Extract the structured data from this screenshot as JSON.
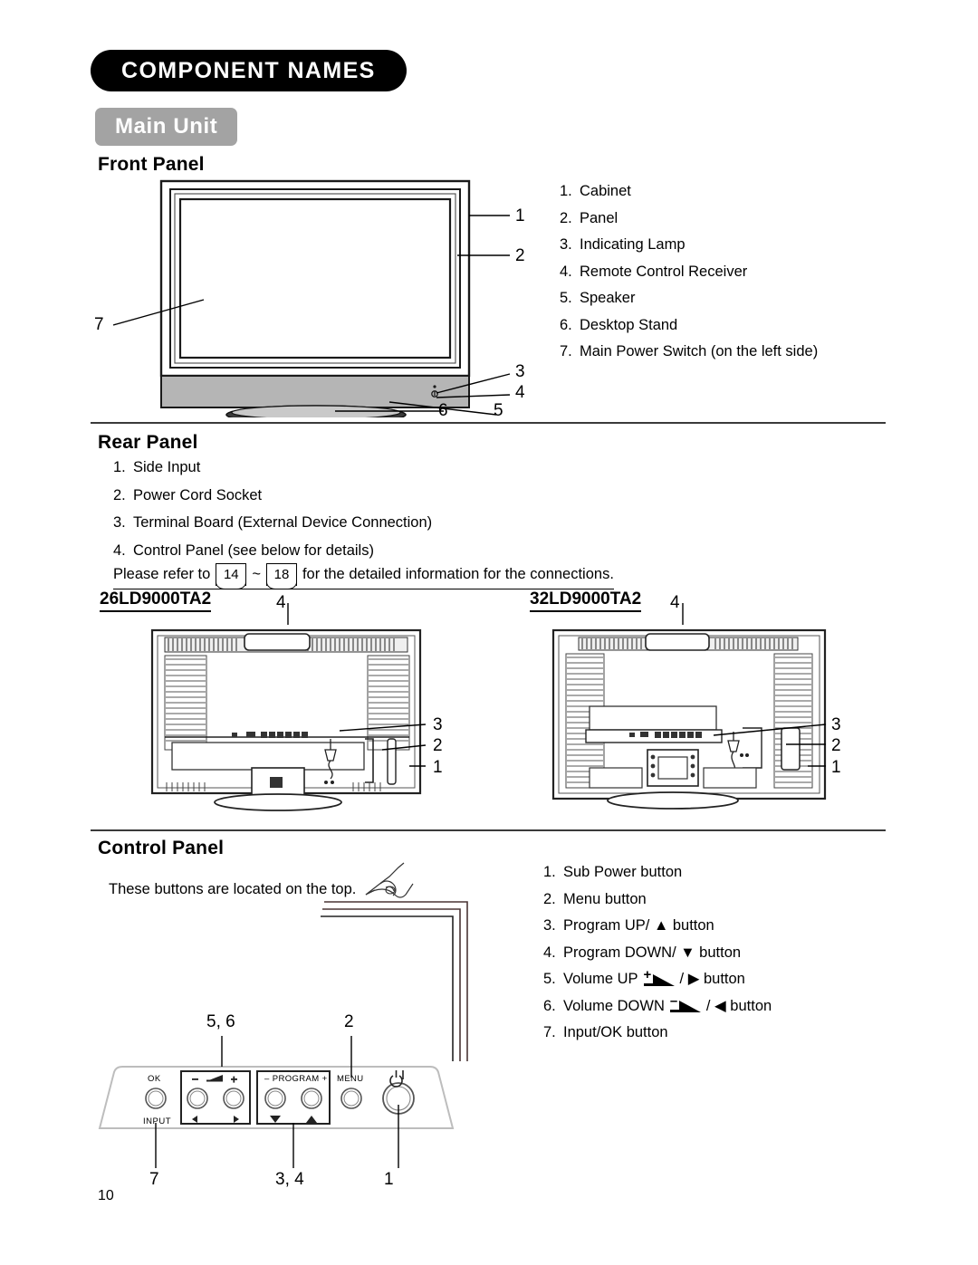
{
  "header": {
    "chapter_title": "COMPONENT NAMES",
    "subsection_title": "Main Unit"
  },
  "front_panel": {
    "heading": "Front Panel",
    "items": [
      {
        "idx": "1.",
        "label": "Cabinet"
      },
      {
        "idx": "2.",
        "label": "Panel"
      },
      {
        "idx": "3.",
        "label": "Indicating Lamp"
      },
      {
        "idx": "4.",
        "label": "Remote Control Receiver"
      },
      {
        "idx": "5.",
        "label": "Speaker"
      },
      {
        "idx": "6.",
        "label": "Desktop Stand"
      },
      {
        "idx": "7.",
        "label": "Main Power Switch (on the left side)"
      }
    ],
    "callouts": [
      "1",
      "2",
      "3",
      "4",
      "5",
      "6",
      "7"
    ]
  },
  "rear_panel": {
    "heading": "Rear Panel",
    "items": [
      {
        "idx": "1.",
        "label": "Side Input"
      },
      {
        "idx": "2.",
        "label": "Power Cord Socket"
      },
      {
        "idx": "3.",
        "label": "Terminal Board (External Device Connection)"
      },
      {
        "idx": "4.",
        "label": "Control Panel (see below for details)"
      }
    ],
    "refer_prefix": "Please refer to",
    "refer_page_from": "14",
    "refer_tilde": "~",
    "refer_page_to": "18",
    "refer_suffix": "for the detailed information for the connections.",
    "models": [
      {
        "name": "26LD9000TA2",
        "callouts": [
          "4",
          "3",
          "2",
          "1"
        ]
      },
      {
        "name": "32LD9000TA2",
        "callouts": [
          "4",
          "3",
          "2",
          "1"
        ]
      }
    ]
  },
  "control_panel": {
    "heading": "Control Panel",
    "note": "These buttons are located on the top.",
    "items": [
      {
        "idx": "1.",
        "label": "Sub Power button"
      },
      {
        "idx": "2.",
        "label": "Menu button"
      },
      {
        "idx": "3.",
        "label": "Program UP/ ▲ button"
      },
      {
        "idx": "4.",
        "label": "Program DOWN/ ▼ button"
      },
      {
        "idx": "5.",
        "label_pre": "Volume UP",
        "glyph": "volume-up-icon",
        "label_post": "/ ▶ button"
      },
      {
        "idx": "6.",
        "label_pre": "Volume DOWN",
        "glyph": "volume-down-icon",
        "label_post": "/ ◀ button"
      },
      {
        "idx": "7.",
        "label": "Input/OK button"
      }
    ],
    "buttons": {
      "ok": "OK",
      "input": "INPUT",
      "volume_minus": "–",
      "volume_plus": "+",
      "program": "– PROGRAM +",
      "menu": "MENU",
      "left_arrow": "◀",
      "right_arrow": "▶",
      "down_arrow": "▼",
      "up_arrow": "▲"
    },
    "callouts_top": [
      "5, 6",
      "2"
    ],
    "callouts_bottom": [
      "7",
      "3, 4",
      "1"
    ]
  },
  "footer": {
    "page_number": "10"
  }
}
